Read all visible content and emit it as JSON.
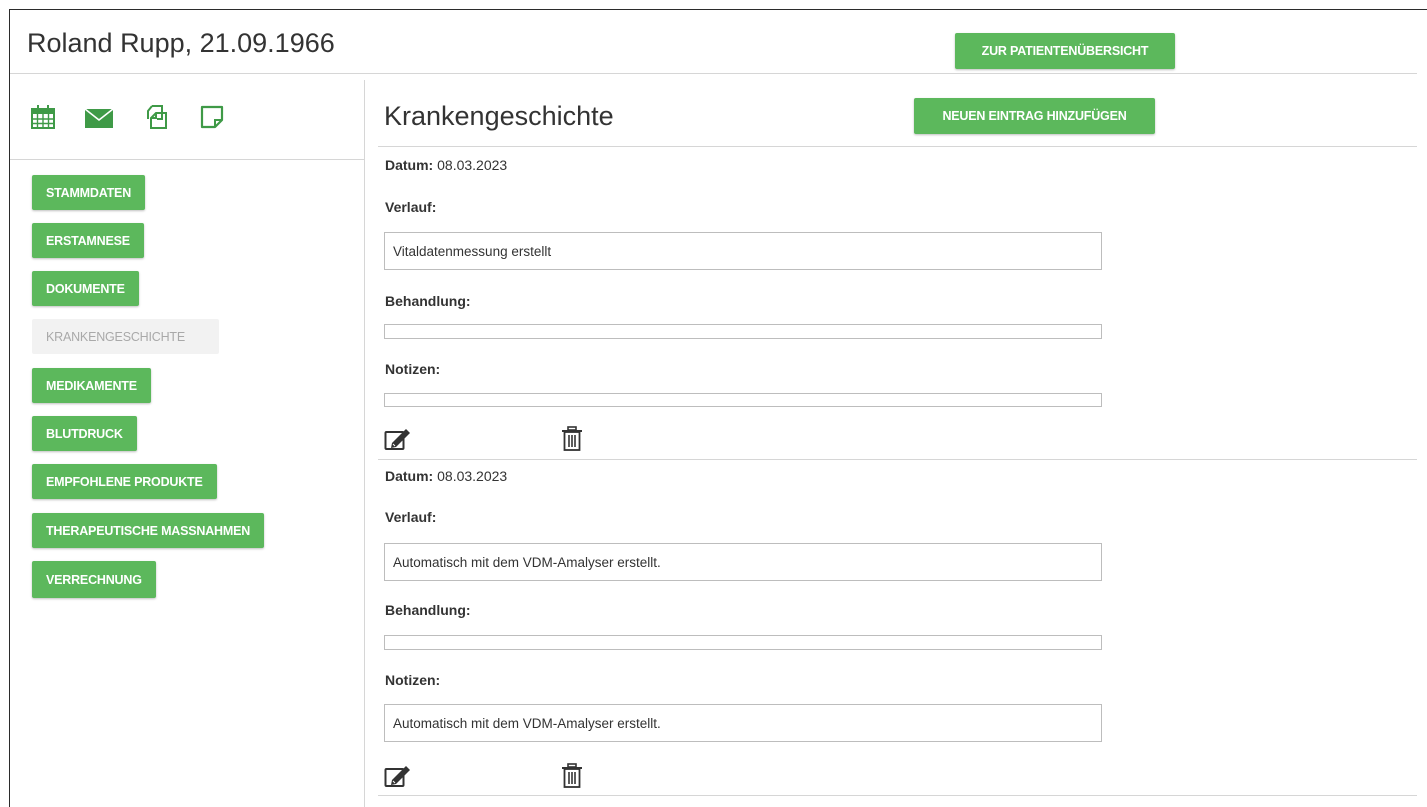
{
  "header": {
    "patient_name": "Roland Rupp, 21.09.1966",
    "overview_button": "ZUR PATIENTENÜBERSICHT"
  },
  "toolbar_icons": [
    "calendar-icon",
    "envelope-icon",
    "copy-icon",
    "note-icon"
  ],
  "sidebar": {
    "items": [
      {
        "label": "STAMMDATEN",
        "active": false
      },
      {
        "label": "ERSTAMNESE",
        "active": false
      },
      {
        "label": "DOKUMENTE",
        "active": false
      },
      {
        "label": "KRANKENGESCHICHTE",
        "active": true
      },
      {
        "label": "MEDIKAMENTE",
        "active": false
      },
      {
        "label": "BLUTDRUCK",
        "active": false
      },
      {
        "label": "EMPFOHLENE PRODUKTE",
        "active": false
      },
      {
        "label": "THERAPEUTISCHE MASSNAHMEN",
        "active": false
      },
      {
        "label": "VERRECHNUNG",
        "active": false
      }
    ]
  },
  "main": {
    "title": "Krankengeschichte",
    "add_button": "NEUEN EINTRAG HINZUFÜGEN",
    "labels": {
      "datum": "Datum:",
      "verlauf": "Verlauf:",
      "behandlung": "Behandlung:",
      "notizen": "Notizen:"
    },
    "entries": [
      {
        "datum": "08.03.2023",
        "verlauf": "Vitaldatenmessung erstellt",
        "behandlung": "",
        "notizen": ""
      },
      {
        "datum": "08.03.2023",
        "verlauf": "Automatisch mit dem VDM-Amalyser erstellt.",
        "behandlung": "",
        "notizen": "Automatisch mit dem VDM-Amalyser erstellt."
      }
    ]
  },
  "colors": {
    "accent_green": "#5cb85c",
    "icon_green": "#3f9a47",
    "disabled_bg": "#f2f2f2",
    "disabled_text": "#a9a9a9"
  }
}
